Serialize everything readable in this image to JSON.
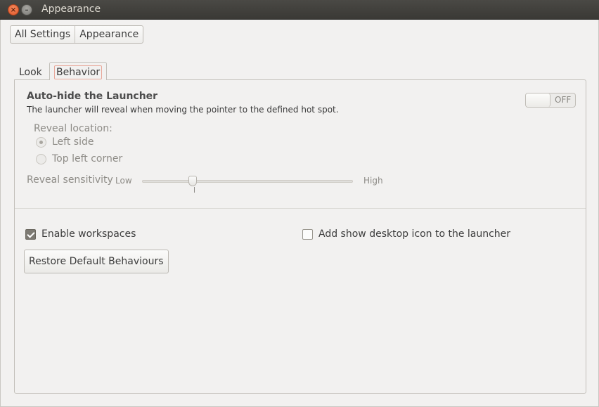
{
  "window": {
    "title": "Appearance"
  },
  "breadcrumb": {
    "items": [
      "All Settings",
      "Appearance"
    ]
  },
  "tabs": [
    {
      "label": "Look",
      "active": false
    },
    {
      "label": "Behavior",
      "active": true
    }
  ],
  "autohide": {
    "title": "Auto-hide the Launcher",
    "description": "The launcher will reveal when moving the pointer to the defined hot spot.",
    "toggle_label": "OFF",
    "enabled": false
  },
  "reveal": {
    "label": "Reveal location:",
    "options": [
      {
        "label": "Left side",
        "selected": true
      },
      {
        "label": "Top left corner",
        "selected": false
      }
    ]
  },
  "sensitivity": {
    "label": "Reveal sensitivity",
    "low_label": "Low",
    "high_label": "High",
    "value": 0.24,
    "tick": 0.245
  },
  "options": {
    "workspaces": {
      "label": "Enable workspaces",
      "checked": true
    },
    "show_desktop": {
      "label": "Add show desktop icon to the launcher",
      "checked": false
    }
  },
  "restore_label": "Restore Default Behaviours",
  "colors": {
    "titlebar": "#3c3b37",
    "close": "#e05a2b",
    "background": "#f2f1f0"
  }
}
